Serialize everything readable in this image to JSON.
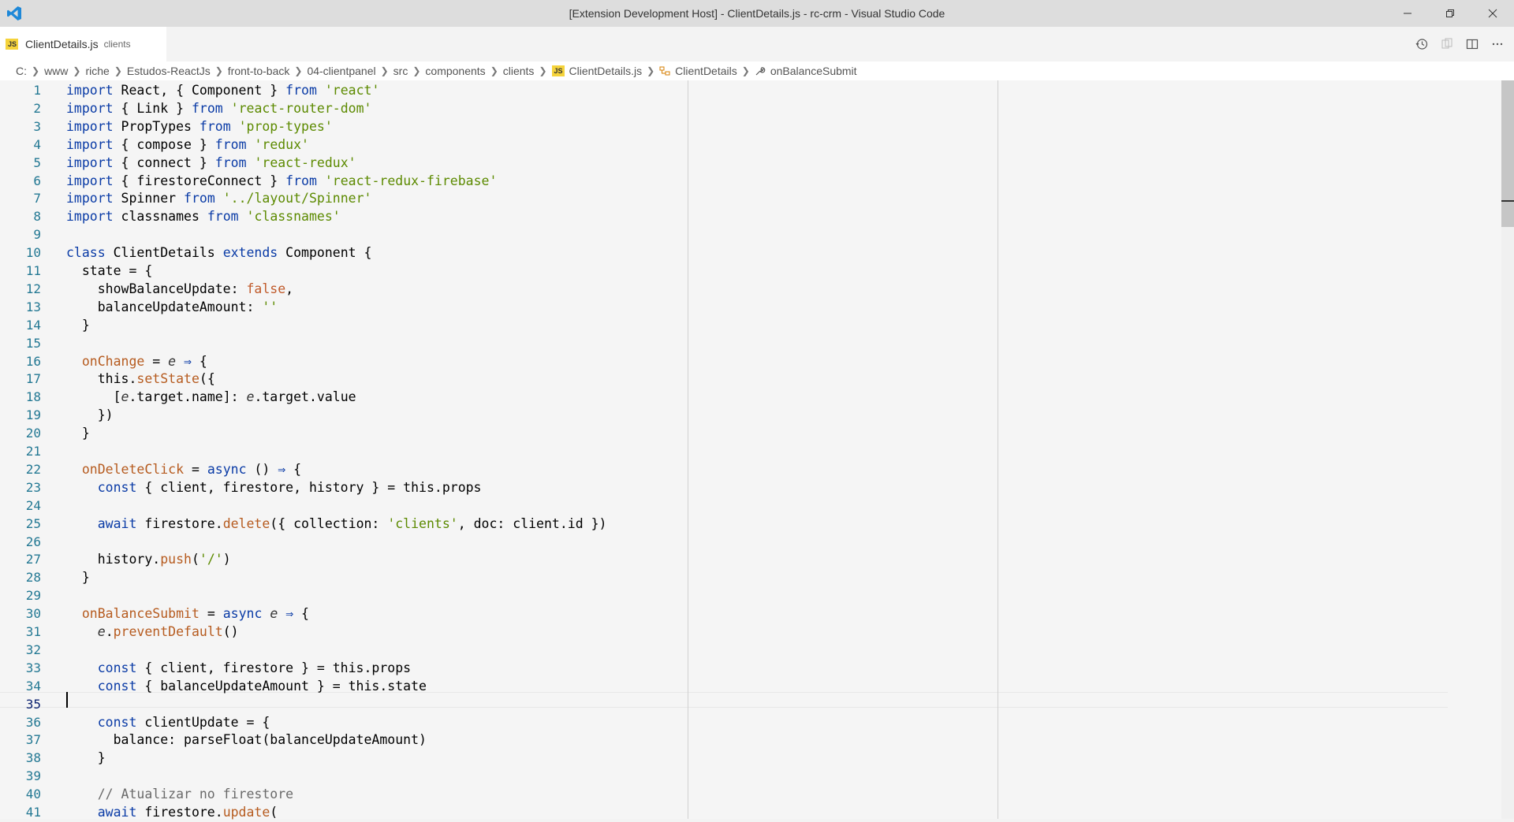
{
  "window": {
    "title": "[Extension Development Host] - ClientDetails.js - rc-crm - Visual Studio Code",
    "controls": [
      "minimize",
      "restore",
      "close"
    ]
  },
  "tab": {
    "filename": "ClientDetails.js",
    "description": "clients",
    "icon_label": "JS"
  },
  "tab_actions": [
    "timeline-icon",
    "compare-icon",
    "split-editor-icon",
    "more-actions-icon"
  ],
  "breadcrumb": {
    "items": [
      "C:",
      "www",
      "riche",
      "Estudos-ReactJs",
      "front-to-back",
      "04-clientpanel",
      "src",
      "components",
      "clients"
    ],
    "file": "ClientDetails.js",
    "symbol_class": "ClientDetails",
    "symbol_method": "onBalanceSubmit"
  },
  "editor": {
    "active_line": 35,
    "lines": [
      {
        "n": "1",
        "tokens": [
          [
            "kw",
            "import"
          ],
          [
            "",
            "React, { Component } "
          ],
          [
            "kw",
            "from"
          ],
          [
            "str",
            " 'react'"
          ]
        ]
      },
      {
        "n": "2",
        "tokens": [
          [
            "kw",
            "import"
          ],
          [
            "",
            "{ Link } "
          ],
          [
            "kw",
            "from"
          ],
          [
            "str",
            " 'react-router-dom'"
          ]
        ]
      },
      {
        "n": "3",
        "tokens": [
          [
            "kw",
            "import"
          ],
          [
            "",
            "PropTypes "
          ],
          [
            "kw",
            "from"
          ],
          [
            "str",
            " 'prop-types'"
          ]
        ]
      },
      {
        "n": "4",
        "tokens": [
          [
            "kw",
            "import"
          ],
          [
            "",
            "{ compose } "
          ],
          [
            "kw",
            "from"
          ],
          [
            "str",
            " 'redux'"
          ]
        ]
      },
      {
        "n": "5",
        "tokens": [
          [
            "kw",
            "import"
          ],
          [
            "",
            "{ connect } "
          ],
          [
            "kw",
            "from"
          ],
          [
            "str",
            " 'react-redux'"
          ]
        ]
      },
      {
        "n": "6",
        "tokens": [
          [
            "kw",
            "import"
          ],
          [
            "",
            "{ firestoreConnect } "
          ],
          [
            "kw",
            "from"
          ],
          [
            "str",
            " 'react-redux-firebase'"
          ]
        ]
      },
      {
        "n": "7",
        "tokens": [
          [
            "kw",
            "import"
          ],
          [
            "",
            "Spinner "
          ],
          [
            "kw",
            "from"
          ],
          [
            "str",
            " '../layout/Spinner'"
          ]
        ]
      },
      {
        "n": "8",
        "tokens": [
          [
            "kw",
            "import"
          ],
          [
            "",
            "classnames "
          ],
          [
            "kw",
            "from"
          ],
          [
            "str",
            " 'classnames'"
          ]
        ]
      },
      {
        "n": "9",
        "tokens": []
      },
      {
        "n": "10",
        "tokens": [
          [
            "kw",
            "class"
          ],
          [
            "",
            " ClientDetails "
          ],
          [
            "kw",
            "extends"
          ],
          [
            "",
            " Component {"
          ]
        ]
      },
      {
        "n": "11",
        "tokens": [
          [
            "",
            "  state = {"
          ]
        ]
      },
      {
        "n": "12",
        "tokens": [
          [
            "",
            "    showBalanceUpdate: "
          ],
          [
            "bool",
            "false"
          ],
          [
            "",
            ","
          ]
        ]
      },
      {
        "n": "13",
        "tokens": [
          [
            "",
            "    balanceUpdateAmount: "
          ],
          [
            "str",
            "''"
          ]
        ]
      },
      {
        "n": "14",
        "tokens": [
          [
            "",
            "  }"
          ]
        ]
      },
      {
        "n": "15",
        "tokens": []
      },
      {
        "n": "16",
        "tokens": [
          [
            "fn",
            "  onChange"
          ],
          [
            "",
            " = "
          ],
          [
            "it",
            "e"
          ],
          [
            "",
            " "
          ],
          [
            "kw",
            "⇒"
          ],
          [
            "",
            " {"
          ]
        ]
      },
      {
        "n": "17",
        "tokens": [
          [
            "",
            "    this."
          ],
          [
            "fn",
            "setState"
          ],
          [
            "",
            "({"
          ]
        ]
      },
      {
        "n": "18",
        "tokens": [
          [
            "",
            "      ["
          ],
          [
            "it",
            "e"
          ],
          [
            "",
            ".target.name]: "
          ],
          [
            "it",
            "e"
          ],
          [
            "",
            ".target.value"
          ]
        ]
      },
      {
        "n": "19",
        "tokens": [
          [
            "",
            "    })"
          ]
        ]
      },
      {
        "n": "20",
        "tokens": [
          [
            "",
            "  }"
          ]
        ]
      },
      {
        "n": "21",
        "tokens": []
      },
      {
        "n": "22",
        "tokens": [
          [
            "fn",
            "  onDeleteClick"
          ],
          [
            "",
            " = "
          ],
          [
            "kw",
            "async"
          ],
          [
            "",
            " () "
          ],
          [
            "kw",
            "⇒"
          ],
          [
            "",
            " {"
          ]
        ]
      },
      {
        "n": "23",
        "tokens": [
          [
            "kw",
            "    const"
          ],
          [
            "",
            " { client, firestore, history } = this.props"
          ]
        ]
      },
      {
        "n": "24",
        "tokens": []
      },
      {
        "n": "25",
        "tokens": [
          [
            "kw",
            "    await"
          ],
          [
            "",
            " firestore."
          ],
          [
            "fn",
            "delete"
          ],
          [
            "",
            "({ collection: "
          ],
          [
            "str",
            "'clients'"
          ],
          [
            "",
            ", doc: client.id })"
          ]
        ]
      },
      {
        "n": "26",
        "tokens": []
      },
      {
        "n": "27",
        "tokens": [
          [
            "",
            "    history."
          ],
          [
            "fn",
            "push"
          ],
          [
            "",
            "("
          ],
          [
            "str",
            "'/'"
          ],
          [
            "",
            ")"
          ]
        ]
      },
      {
        "n": "28",
        "tokens": [
          [
            "",
            "  }"
          ]
        ]
      },
      {
        "n": "29",
        "tokens": []
      },
      {
        "n": "30",
        "tokens": [
          [
            "fn",
            "  onBalanceSubmit"
          ],
          [
            "",
            " = "
          ],
          [
            "kw",
            "async"
          ],
          [
            "",
            " "
          ],
          [
            "it",
            "e"
          ],
          [
            "",
            " "
          ],
          [
            "kw",
            "⇒"
          ],
          [
            "",
            " {"
          ]
        ]
      },
      {
        "n": "31",
        "tokens": [
          [
            "",
            "    "
          ],
          [
            "it",
            "e"
          ],
          [
            "",
            "."
          ],
          [
            "fn",
            "preventDefault"
          ],
          [
            "",
            "()"
          ]
        ]
      },
      {
        "n": "32",
        "tokens": []
      },
      {
        "n": "33",
        "tokens": [
          [
            "kw",
            "    const"
          ],
          [
            "",
            " { client, firestore } = this.props"
          ]
        ]
      },
      {
        "n": "34",
        "tokens": [
          [
            "kw",
            "    const"
          ],
          [
            "",
            " { balanceUpdateAmount } = this.state"
          ]
        ]
      },
      {
        "n": "35",
        "tokens": []
      },
      {
        "n": "36",
        "tokens": [
          [
            "kw",
            "    const"
          ],
          [
            "",
            " clientUpdate = {"
          ]
        ]
      },
      {
        "n": "37",
        "tokens": [
          [
            "",
            "      balance: parseFloat(balanceUpdateAmount)"
          ]
        ]
      },
      {
        "n": "38",
        "tokens": [
          [
            "",
            "    }"
          ]
        ]
      },
      {
        "n": "39",
        "tokens": []
      },
      {
        "n": "40",
        "tokens": [
          [
            "cm",
            "    // Atualizar no firestore"
          ]
        ]
      },
      {
        "n": "41",
        "tokens": [
          [
            "kw",
            "    await"
          ],
          [
            "",
            " firestore."
          ],
          [
            "fn",
            "update"
          ],
          [
            "",
            "("
          ]
        ]
      }
    ]
  },
  "colors": {
    "keyword": "#0a3ba6",
    "string": "#5c8a00",
    "function": "#b65b1f",
    "comment": "#6a6a6a",
    "line_number": "#237893"
  }
}
